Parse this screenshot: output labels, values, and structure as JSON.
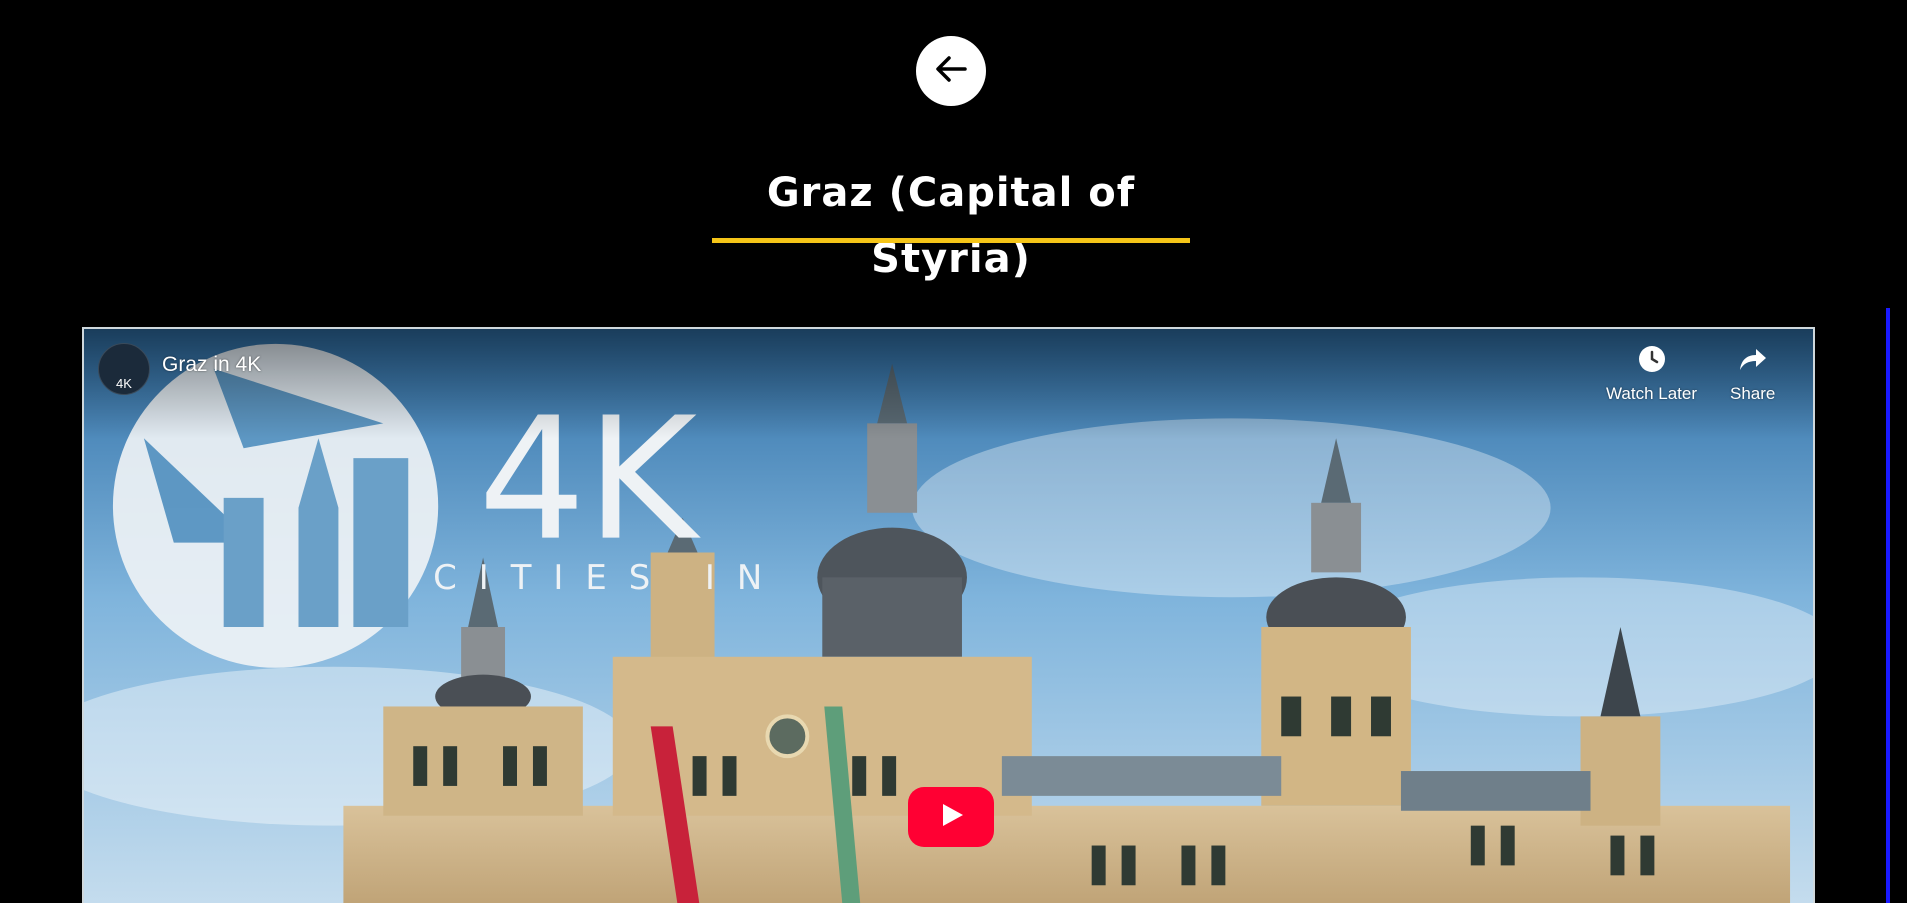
{
  "header": {
    "back_icon": "arrow-left-icon",
    "title": "Graz (Capital of Styria)",
    "accent_color": "#f5c518"
  },
  "video": {
    "title": "Graz in 4K",
    "channel_avatar_text": "4K",
    "logo_text": "4K",
    "logo_subtext": "CITIES IN",
    "actions": [
      {
        "label": "Watch Later",
        "icon": "clock-icon"
      },
      {
        "label": "Share",
        "icon": "share-arrow-icon"
      }
    ],
    "play_icon": "play-icon",
    "play_color": "#ff0033"
  }
}
